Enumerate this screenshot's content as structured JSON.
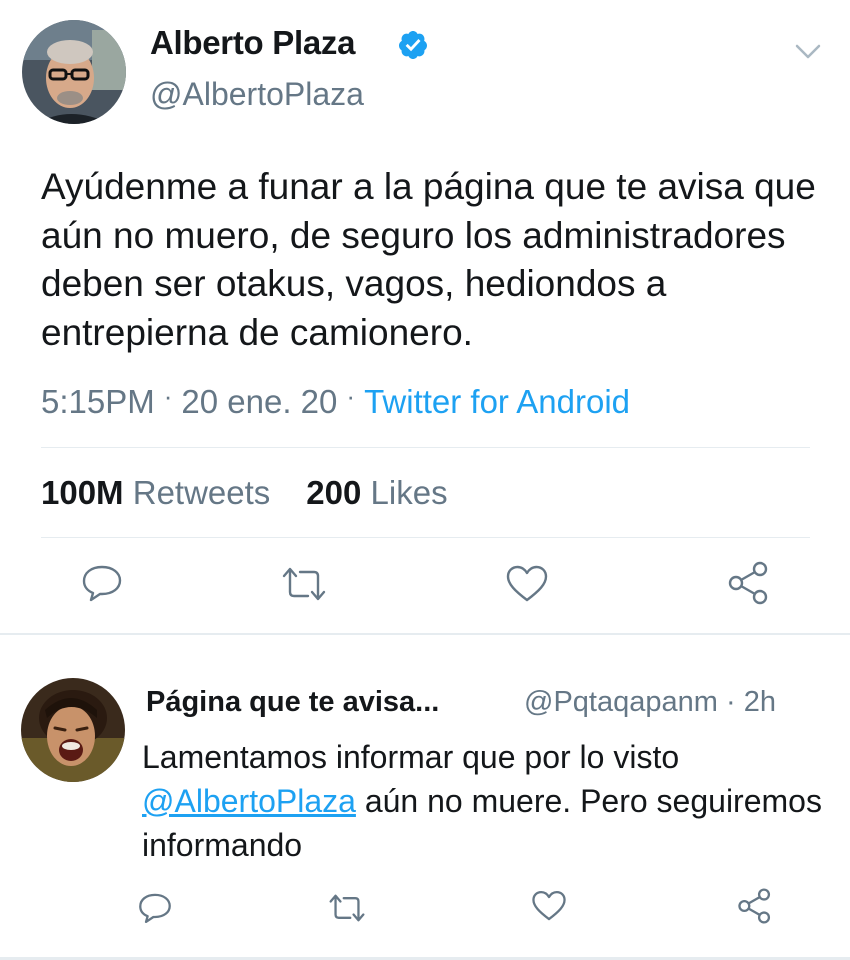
{
  "main_tweet": {
    "author_name": "Alberto Plaza",
    "verified_icon": "verified-badge-icon",
    "handle": "@AlbertoPlaza",
    "text": "Ayúdenme a funar a la página que te avisa que aún no muero, de seguro los administradores deben ser otakus, vagos, hediondos a entrepierna de camionero.",
    "time": "5:15PM",
    "date": "20 ene. 20",
    "separator": "·",
    "source": "Twitter for Android",
    "retweets_count": "100M",
    "retweets_label": "Retweets",
    "likes_count": "200",
    "likes_label": "Likes",
    "actions": [
      "reply-icon",
      "retweet-icon",
      "like-icon",
      "share-icon"
    ]
  },
  "reply_tweet": {
    "author_name": "Página que te avisa...",
    "handle": "@Pqtaqapanm",
    "separator": "·",
    "time": "2h",
    "text_before": "Lamentamos informar que por lo visto",
    "mention": "@AlbertoPlaza",
    "text_after": " aún no muere. Pero seguiremos informando",
    "actions": [
      "reply-icon",
      "retweet-icon",
      "like-icon",
      "share-icon"
    ]
  },
  "colors": {
    "text": "#14171a",
    "secondary": "#657786",
    "accent": "#1da1f2",
    "divider": "#e6ecf0"
  }
}
